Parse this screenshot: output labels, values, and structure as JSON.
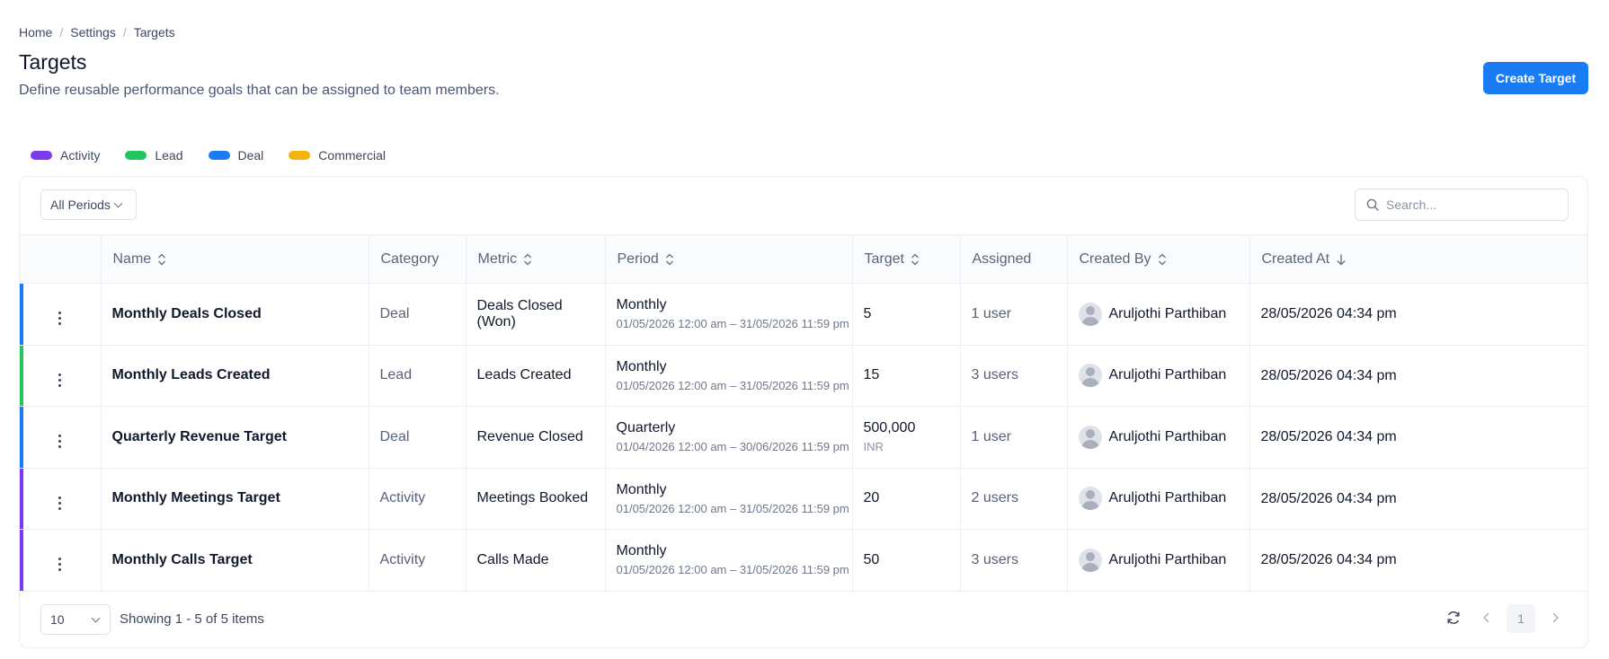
{
  "breadcrumb": {
    "items": [
      "Home",
      "Settings",
      "Targets"
    ],
    "separator": "/"
  },
  "header": {
    "title": "Targets",
    "description": "Define reusable performance goals that can be assigned to team members.",
    "create_button": "Create Target"
  },
  "legend": [
    {
      "label": "Activity",
      "color": "#7c3aed"
    },
    {
      "label": "Lead",
      "color": "#22c55e"
    },
    {
      "label": "Deal",
      "color": "#1a7cf5"
    },
    {
      "label": "Commercial",
      "color": "#f5b40b"
    }
  ],
  "filters": {
    "period": "All Periods",
    "search_placeholder": "Search..."
  },
  "table": {
    "columns": [
      "Name",
      "Category",
      "Metric",
      "Period",
      "Target",
      "Assigned",
      "Created By",
      "Created At"
    ],
    "rows": [
      {
        "name": "Monthly Deals Closed",
        "category": "Deal",
        "metric": "Deals Closed (Won)",
        "period": "Monthly",
        "period_range": "01/05/2026 12:00 am – 31/05/2026 11:59 pm",
        "target": "5",
        "target_unit": "",
        "assigned": "1 user",
        "created_by": "Aruljothi Parthiban",
        "created_at": "28/05/2026 04:34 pm",
        "color": "#1a7cf5"
      },
      {
        "name": "Monthly Leads Created",
        "category": "Lead",
        "metric": "Leads Created",
        "period": "Monthly",
        "period_range": "01/05/2026 12:00 am – 31/05/2026 11:59 pm",
        "target": "15",
        "target_unit": "",
        "assigned": "3 users",
        "created_by": "Aruljothi Parthiban",
        "created_at": "28/05/2026 04:34 pm",
        "color": "#22c55e"
      },
      {
        "name": "Quarterly Revenue Target",
        "category": "Deal",
        "metric": "Revenue Closed",
        "period": "Quarterly",
        "period_range": "01/04/2026 12:00 am – 30/06/2026 11:59 pm",
        "target": "500,000",
        "target_unit": "INR",
        "assigned": "1 user",
        "created_by": "Aruljothi Parthiban",
        "created_at": "28/05/2026 04:34 pm",
        "color": "#1a7cf5"
      },
      {
        "name": "Monthly Meetings Target",
        "category": "Activity",
        "metric": "Meetings Booked",
        "period": "Monthly",
        "period_range": "01/05/2026 12:00 am – 31/05/2026 11:59 pm",
        "target": "20",
        "target_unit": "",
        "assigned": "2 users",
        "created_by": "Aruljothi Parthiban",
        "created_at": "28/05/2026 04:34 pm",
        "color": "#7c3aed"
      },
      {
        "name": "Monthly Calls Target",
        "category": "Activity",
        "metric": "Calls Made",
        "period": "Monthly",
        "period_range": "01/05/2026 12:00 am – 31/05/2026 11:59 pm",
        "target": "50",
        "target_unit": "",
        "assigned": "3 users",
        "created_by": "Aruljothi Parthiban",
        "created_at": "28/05/2026 04:34 pm",
        "color": "#7c3aed"
      }
    ]
  },
  "pagination": {
    "page_size": "10",
    "showing": "Showing 1 - 5 of 5 items",
    "current_page": "1"
  },
  "icons": {
    "search": "search-icon",
    "sort": "sort-icon",
    "sort_desc": "arrow-down-icon",
    "more": "kebab-icon",
    "refresh": "refresh-icon",
    "prev": "chevron-left-icon",
    "next": "chevron-right-icon",
    "avatar": "user-avatar-icon"
  }
}
